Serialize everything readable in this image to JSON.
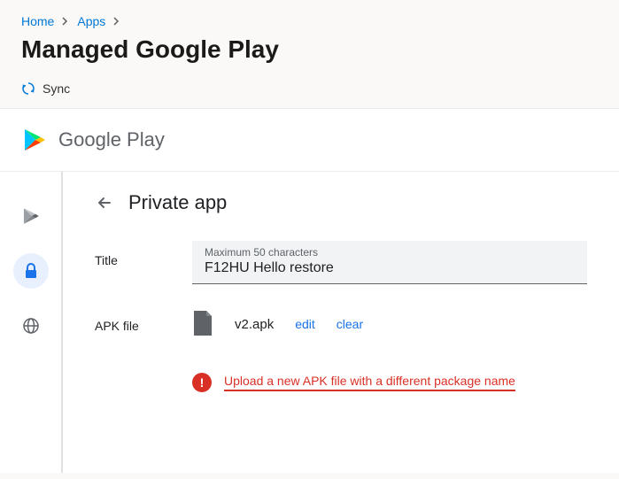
{
  "breadcrumb": {
    "home": "Home",
    "apps": "Apps"
  },
  "page_title": "Managed Google Play",
  "toolbar": {
    "sync": "Sync"
  },
  "play_header": "Google Play",
  "private_app": {
    "heading": "Private app",
    "title_label": "Title",
    "title_helper": "Maximum 50 characters",
    "title_value": "F12HU Hello restore",
    "apk_label": "APK file",
    "apk_name": "v2.apk",
    "edit": "edit",
    "clear": "clear"
  },
  "alert": {
    "exclaim": "!",
    "text": "Upload a new APK file with a different package name"
  }
}
